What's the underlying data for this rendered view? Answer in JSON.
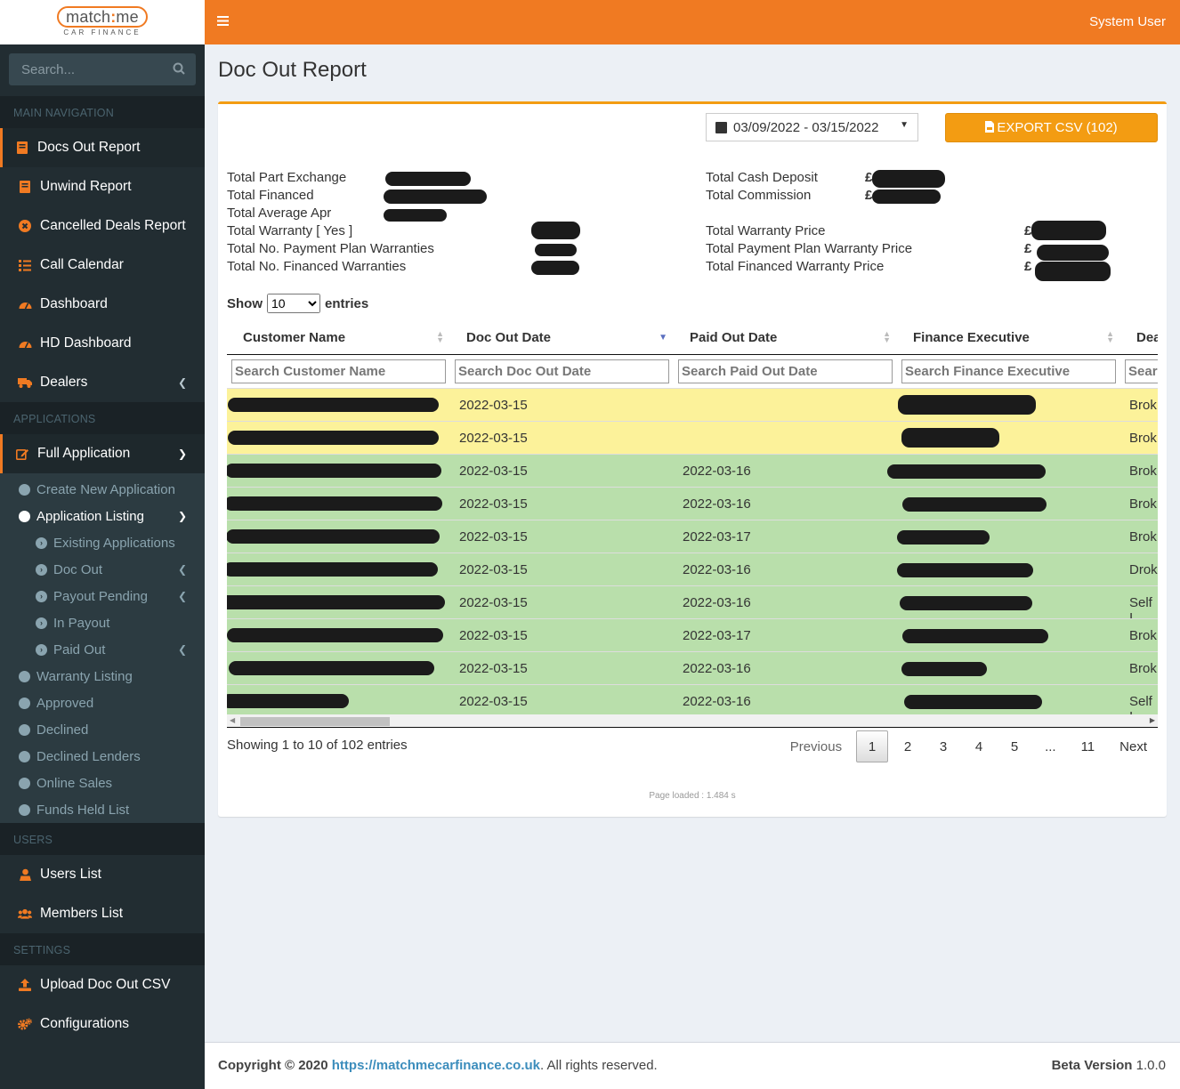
{
  "logo": {
    "brand_a": "match",
    "brand_colon": ":",
    "brand_b": "me",
    "tagline": "CAR FINANCE"
  },
  "search": {
    "placeholder": "Search..."
  },
  "nav": {
    "main_header": "MAIN NAVIGATION",
    "main_items": [
      {
        "label": "Docs Out Report",
        "icon": "book-icon"
      },
      {
        "label": "Unwind Report",
        "icon": "book-icon"
      },
      {
        "label": "Cancelled Deals Report",
        "icon": "times-circle-icon"
      },
      {
        "label": "Call Calendar",
        "icon": "tasks-icon"
      },
      {
        "label": "Dashboard",
        "icon": "tachometer-icon"
      },
      {
        "label": "HD Dashboard",
        "icon": "tachometer-icon"
      },
      {
        "label": "Dealers",
        "icon": "truck-icon"
      }
    ],
    "applications_header": "APPLICATIONS",
    "full_application": "Full Application",
    "create_new": "Create New Application",
    "app_listing": "Application Listing",
    "listing_sub": [
      "Existing Applications",
      "Doc Out",
      "Payout Pending",
      "In Payout",
      "Paid Out"
    ],
    "other_sub": [
      "Warranty Listing",
      "Approved",
      "Declined",
      "Declined Lenders",
      "Online Sales",
      "Funds Held List"
    ],
    "users_header": "USERS",
    "users_items": [
      "Users List",
      "Members List"
    ],
    "settings_header": "SETTINGS",
    "settings_items": [
      "Upload Doc Out CSV",
      "Configurations"
    ]
  },
  "header": {
    "menu_icon": "bars-icon",
    "user": "System User"
  },
  "page": {
    "title": "Doc Out Report",
    "date_range": "03/09/2022 - 03/15/2022",
    "export_label": "EXPORT CSV (102)"
  },
  "stats": {
    "part_exchange": "Total Part Exchange",
    "financed": "Total Financed",
    "average_apr": "Total Average Apr",
    "warranty_yes": "Total Warranty [ Yes ]",
    "payment_plan_warranties": "Total No. Payment Plan Warranties",
    "financed_warranties": "Total No. Financed Warranties",
    "cash_deposit": "Total Cash Deposit",
    "commission": "Total Commission",
    "warranty_price": "Total Warranty Price",
    "payment_plan_warranty_price": "Total Payment Plan Warranty Price",
    "financed_warranty_price": "Total Financed Warranty Price",
    "currency": "£"
  },
  "table": {
    "show": "Show",
    "entries": "entries",
    "page_length": "10",
    "columns": [
      "Customer Name",
      "Doc Out Date",
      "Paid Out Date",
      "Finance Executive",
      "Dea"
    ],
    "filters": [
      "Search Customer Name",
      "Search Doc Out Date",
      "Search Paid Out Date",
      "Search Finance Executive",
      "Sear"
    ],
    "rows": [
      {
        "doc_out": "2022-03-15",
        "paid_out": "",
        "dealer": "Brok",
        "status": "yellow"
      },
      {
        "doc_out": "2022-03-15",
        "paid_out": "",
        "dealer": "Brok",
        "status": "yellow"
      },
      {
        "doc_out": "2022-03-15",
        "paid_out": "2022-03-16",
        "dealer": "Brok",
        "status": "green"
      },
      {
        "doc_out": "2022-03-15",
        "paid_out": "2022-03-16",
        "dealer": "Brok",
        "status": "green"
      },
      {
        "doc_out": "2022-03-15",
        "paid_out": "2022-03-17",
        "dealer": "Brok",
        "status": "green"
      },
      {
        "doc_out": "2022-03-15",
        "paid_out": "2022-03-16",
        "dealer": "Drok",
        "status": "green"
      },
      {
        "doc_out": "2022-03-15",
        "paid_out": "2022-03-16",
        "dealer": "Self I",
        "status": "green"
      },
      {
        "doc_out": "2022-03-15",
        "paid_out": "2022-03-17",
        "dealer": "Brok",
        "status": "green"
      },
      {
        "doc_out": "2022-03-15",
        "paid_out": "2022-03-16",
        "dealer": "Brok",
        "status": "green"
      },
      {
        "doc_out": "2022-03-15",
        "paid_out": "2022-03-16",
        "dealer": "Self I",
        "status": "green"
      }
    ],
    "info": "Showing 1 to 10 of 102 entries",
    "pagination": [
      "Previous",
      "1",
      "2",
      "3",
      "4",
      "5",
      "...",
      "11",
      "Next"
    ]
  },
  "page_loaded": "Page loaded : 1.484 s",
  "footer": {
    "copyright": "Copyright © 2020",
    "link": "https://matchmecarfinance.co.uk",
    "rights": ". All rights reserved.",
    "version_label": "Beta Version",
    "version": "1.0.0"
  },
  "colors": {
    "brand": "#f07a22",
    "export": "#f39c12",
    "row_yellow": "#fcf29a",
    "row_green": "#b9dfab",
    "sidebar": "#222d32"
  }
}
